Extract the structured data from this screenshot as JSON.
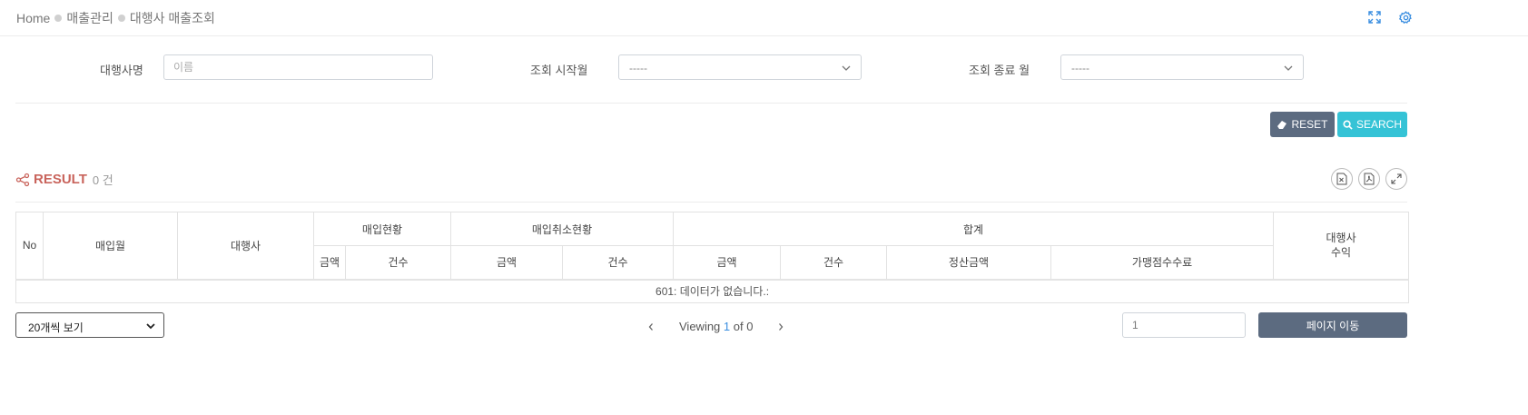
{
  "breadcrumb": {
    "home": "Home",
    "level1": "매출관리",
    "level2": "대행사 매출조회"
  },
  "filters": {
    "agency_name_label": "대행사명",
    "agency_name_placeholder": "이름",
    "start_month_label": "조회 시작월",
    "start_month_value": "-----",
    "end_month_label": "조회 종료 월",
    "end_month_value": "-----"
  },
  "buttons": {
    "reset": "RESET",
    "search": "SEARCH"
  },
  "result": {
    "title": "RESULT",
    "count": "0 건"
  },
  "table": {
    "col_no": "No",
    "col_month": "매입월",
    "col_agency": "대행사",
    "group_purchase": "매입현황",
    "group_cancel": "매입취소현황",
    "group_total": "합계",
    "col_agency_profit": "대행사\n수익",
    "sub_amount": "금액",
    "sub_count": "건수",
    "sub_settlement": "정산금액",
    "sub_merchant_fee": "가맹점수수료",
    "empty_message": "601: 데이터가 없습니다.:"
  },
  "footer": {
    "page_size": "20개씩 보기",
    "viewing_prefix": "Viewing",
    "viewing_current": "1",
    "viewing_of": "of 0",
    "goto_value": "1",
    "goto_button": "페이지 이동"
  },
  "colors": {
    "reset_bg": "#5c6b80",
    "search_bg": "#35c3d6",
    "result_title": "#c9645c",
    "pager_current": "#3a8ee0"
  }
}
